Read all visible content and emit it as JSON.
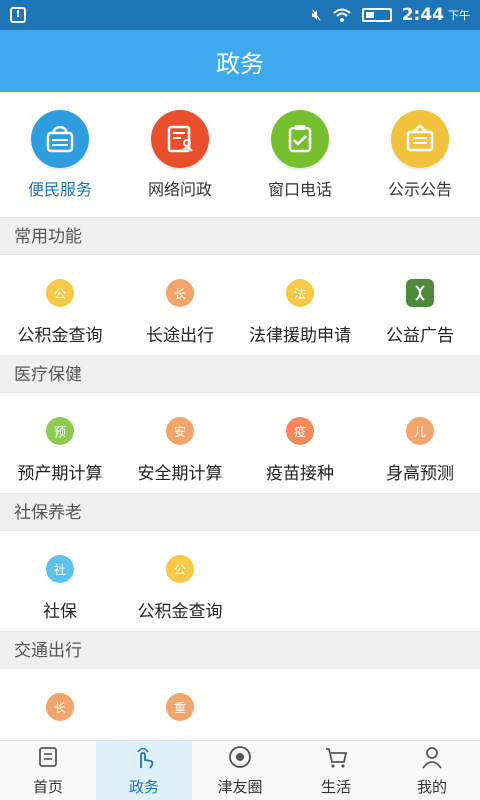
{
  "status": {
    "time": "2:44",
    "ampm": "下午",
    "warn": "!"
  },
  "title": "政务",
  "top_items": [
    {
      "label": "便民服务",
      "color": "#2e9ee0",
      "icon": "bag-icon",
      "active": true
    },
    {
      "label": "网络问政",
      "color": "#ea4f2c",
      "icon": "document-user-icon"
    },
    {
      "label": "窗口电话",
      "color": "#76c030",
      "icon": "clipboard-check-icon"
    },
    {
      "label": "公示公告",
      "color": "#f2c23d",
      "icon": "notice-icon"
    }
  ],
  "sections": [
    {
      "title": "常用功能",
      "items": [
        {
          "label": "公积金查询",
          "char": "公",
          "color": "#f5c845"
        },
        {
          "label": "长途出行",
          "char": "长",
          "color": "#f2a56b"
        },
        {
          "label": "法律援助申请",
          "char": "法",
          "color": "#f5c845"
        },
        {
          "label": "公益广告",
          "char": "",
          "color": "#4f8a3c",
          "icon": "dna-icon"
        }
      ]
    },
    {
      "title": "医疗保健",
      "items": [
        {
          "label": "预产期计算",
          "char": "预",
          "color": "#8ccc4c"
        },
        {
          "label": "安全期计算",
          "char": "安",
          "color": "#f2a56b"
        },
        {
          "label": "疫苗接种",
          "char": "疫",
          "color": "#f08a5a"
        },
        {
          "label": "身高预测",
          "char": "儿",
          "color": "#f2a56b"
        }
      ]
    },
    {
      "title": "社保养老",
      "items": [
        {
          "label": "社保",
          "char": "社",
          "color": "#5ac3e8"
        },
        {
          "label": "公积金查询",
          "char": "公",
          "color": "#f5c845"
        }
      ]
    },
    {
      "title": "交通出行",
      "items": [
        {
          "label": "",
          "char": "长",
          "color": "#f2a56b"
        },
        {
          "label": "",
          "char": "重",
          "color": "#f2a56b"
        }
      ]
    }
  ],
  "tabs": [
    {
      "label": "首页",
      "icon": "home-icon"
    },
    {
      "label": "政务",
      "icon": "hand-tap-icon",
      "active": true
    },
    {
      "label": "津友圈",
      "icon": "aperture-icon"
    },
    {
      "label": "生活",
      "icon": "cart-icon"
    },
    {
      "label": "我的",
      "icon": "user-icon"
    }
  ]
}
